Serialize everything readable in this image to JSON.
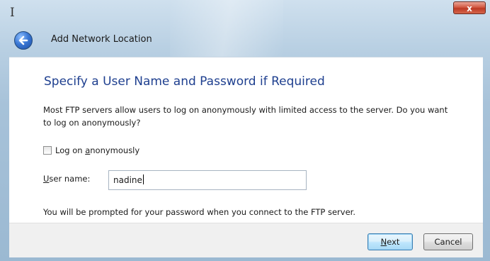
{
  "window": {
    "title": "Add Network Location",
    "close_label": "x"
  },
  "page": {
    "heading": "Specify a User Name and Password if Required",
    "intro_line1": "Most FTP servers allow users to log on anonymously with limited access to the server.  Do you want",
    "intro_line2": "to log on anonymously?",
    "checkbox": {
      "label_pre": "Log on ",
      "label_accel": "a",
      "label_post": "nonymously",
      "checked": false
    },
    "username": {
      "label_accel": "U",
      "label_post": "ser name:",
      "value": "nadine"
    },
    "note": "You will be prompted for your password when you connect to the FTP server."
  },
  "buttons": {
    "next_accel": "N",
    "next_post": "ext",
    "cancel": "Cancel"
  },
  "colors": {
    "heading": "#1e3f8f",
    "close": "#c94a33",
    "accent": "#3a78d4"
  },
  "icons": {
    "back": "back-arrow-icon",
    "cursor": "text-cursor-icon"
  }
}
